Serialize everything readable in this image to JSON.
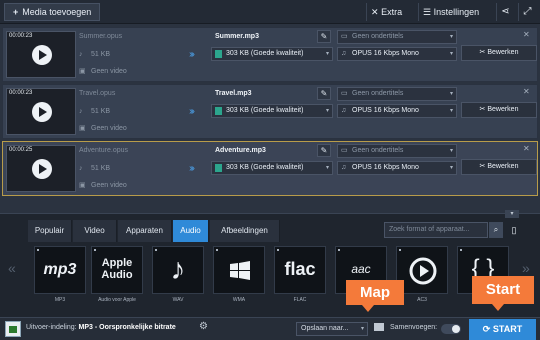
{
  "toolbar": {
    "add_media_label": "Media toevoegen",
    "extra_label": "Extra",
    "settings_label": "Instellingen"
  },
  "files": [
    {
      "duration": "00:00:23",
      "source_name": "Summer.opus",
      "source_size": "51 KB",
      "no_video": "Geen video",
      "output_name": "Summer.mp3",
      "quality": "303 KB (Goede kwaliteit)",
      "subtitles": "Geen ondertitels",
      "audio": "OPUS 16 Kbps Mono",
      "edit_label": "Bewerken"
    },
    {
      "duration": "00:00:23",
      "source_name": "Travel.opus",
      "source_size": "51 KB",
      "no_video": "Geen video",
      "output_name": "Travel.mp3",
      "quality": "303 KB (Goede kwaliteit)",
      "subtitles": "Geen ondertitels",
      "audio": "OPUS 16 Kbps Mono",
      "edit_label": "Bewerken"
    },
    {
      "duration": "00:00:25",
      "source_name": "Adventure.opus",
      "source_size": "51 KB",
      "no_video": "Geen video",
      "output_name": "Adventure.mp3",
      "quality": "303 KB (Goede kwaliteit)",
      "subtitles": "Geen ondertitels",
      "audio": "OPUS 16 Kbps Mono",
      "edit_label": "Bewerken"
    }
  ],
  "format_tabs": [
    "Populair",
    "Video",
    "Apparaten",
    "Audio",
    "Afbeeldingen"
  ],
  "active_tab": "Audio",
  "search": {
    "placeholder": "Zoek format of apparaat..."
  },
  "formats": [
    {
      "label": "MP3",
      "glyph": "mp3"
    },
    {
      "label": "Audio voor Apple",
      "glyph": "Apple Audio"
    },
    {
      "label": "WAV",
      "glyph": "♪"
    },
    {
      "label": "WMA",
      "glyph": "windows-icon"
    },
    {
      "label": "FLAC",
      "glyph": "flac"
    },
    {
      "label": "AAC",
      "glyph": "aac"
    },
    {
      "label": "AC3",
      "glyph": "ac3-icon"
    },
    {
      "label": "",
      "glyph": "ogg-icon"
    }
  ],
  "callouts": {
    "map": "Map",
    "start": "Start"
  },
  "status": {
    "output_format_prefix": "Uitvoer-indeling:",
    "output_format_value": "MP3 - Oorspronkelijke bitrate",
    "save_to": "Opslaan naar...",
    "merge_label": "Samenvoegen:",
    "start_label": "START"
  },
  "colors": {
    "accent": "#2f8ad8",
    "callout": "#f47a3a",
    "selected_border": "#b89c4a"
  }
}
